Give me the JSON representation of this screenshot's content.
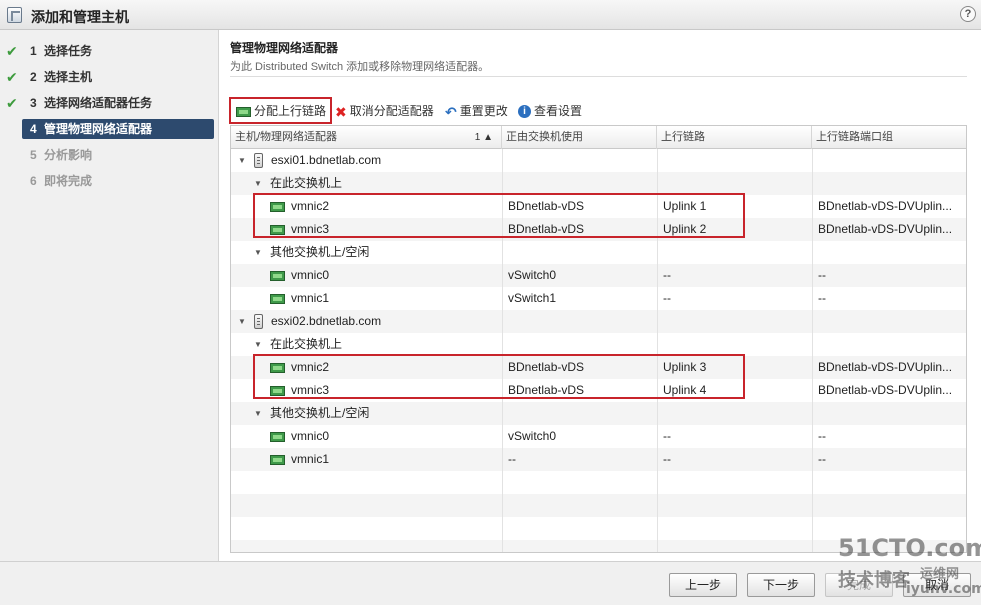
{
  "window": {
    "title": "添加和管理主机",
    "help_glyph": "?"
  },
  "steps": [
    {
      "num": "1",
      "label": "选择任务",
      "state": "done"
    },
    {
      "num": "2",
      "label": "选择主机",
      "state": "done"
    },
    {
      "num": "3",
      "label": "选择网络适配器任务",
      "state": "done"
    },
    {
      "num": "4",
      "label": "管理物理网络适配器",
      "state": "active"
    },
    {
      "num": "5",
      "label": "分析影响",
      "state": "disabled"
    },
    {
      "num": "6",
      "label": "即将完成",
      "state": "disabled"
    }
  ],
  "page": {
    "title": "管理物理网络适配器",
    "subtitle": "为此 Distributed Switch 添加或移除物理网络适配器。"
  },
  "toolbar": {
    "assign_uplink": "分配上行链路",
    "unassign_adapter": "取消分配适配器",
    "reset_changes": "重置更改",
    "view_settings": "查看设置"
  },
  "grid": {
    "columns": [
      "主机/物理网络适配器",
      "正由交换机使用",
      "上行链路",
      "上行链路端口组"
    ],
    "sort_indicator": "1 ▲",
    "rows": [
      {
        "kind": "host",
        "name": "esxi01.bdnetlab.com",
        "switch": "",
        "uplink": "",
        "portgroup": ""
      },
      {
        "kind": "group",
        "name": "在此交换机上",
        "switch": "",
        "uplink": "",
        "portgroup": ""
      },
      {
        "kind": "nic",
        "name": "vmnic2",
        "switch": "BDnetlab-vDS",
        "uplink": "Uplink 1",
        "portgroup": "BDnetlab-vDS-DVUplin..."
      },
      {
        "kind": "nic",
        "name": "vmnic3",
        "switch": "BDnetlab-vDS",
        "uplink": "Uplink 2",
        "portgroup": "BDnetlab-vDS-DVUplin..."
      },
      {
        "kind": "group",
        "name": "其他交换机上/空闲",
        "switch": "",
        "uplink": "",
        "portgroup": ""
      },
      {
        "kind": "nic",
        "name": "vmnic0",
        "switch": "vSwitch0",
        "uplink": "--",
        "portgroup": "--"
      },
      {
        "kind": "nic",
        "name": "vmnic1",
        "switch": "vSwitch1",
        "uplink": "--",
        "portgroup": "--"
      },
      {
        "kind": "host",
        "name": "esxi02.bdnetlab.com",
        "switch": "",
        "uplink": "",
        "portgroup": ""
      },
      {
        "kind": "group",
        "name": "在此交换机上",
        "switch": "",
        "uplink": "",
        "portgroup": ""
      },
      {
        "kind": "nic",
        "name": "vmnic2",
        "switch": "BDnetlab-vDS",
        "uplink": "Uplink 3",
        "portgroup": "BDnetlab-vDS-DVUplin..."
      },
      {
        "kind": "nic",
        "name": "vmnic3",
        "switch": "BDnetlab-vDS",
        "uplink": "Uplink 4",
        "portgroup": "BDnetlab-vDS-DVUplin..."
      },
      {
        "kind": "group",
        "name": "其他交换机上/空闲",
        "switch": "",
        "uplink": "",
        "portgroup": ""
      },
      {
        "kind": "nic",
        "name": "vmnic0",
        "switch": "vSwitch0",
        "uplink": "--",
        "portgroup": "--"
      },
      {
        "kind": "nic",
        "name": "vmnic1",
        "switch": "--",
        "uplink": "--",
        "portgroup": "--"
      }
    ]
  },
  "footer": {
    "back": "上一步",
    "next": "下一步",
    "finish": "完成",
    "cancel": "取消"
  },
  "watermark": {
    "line1": "51CTO.com",
    "line2": "技术博客",
    "line3": "运维网",
    "line4": "iyunv.com"
  },
  "colors": {
    "accent": "#2d4a6e",
    "check": "#3d9b3d",
    "highlight": "#c8242b"
  }
}
